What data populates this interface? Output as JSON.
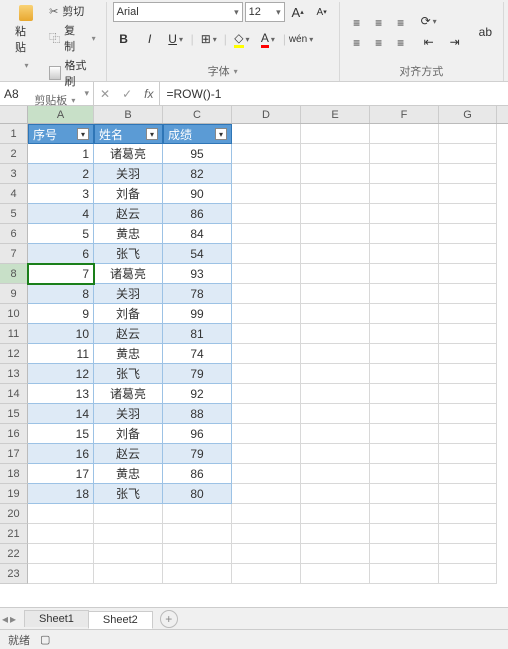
{
  "ribbon": {
    "clipboard": {
      "paste": "粘贴",
      "cut": "剪切",
      "copy": "复制",
      "format_painter": "格式刷",
      "group_label": "剪贴板"
    },
    "font": {
      "name": "Arial",
      "size": "12",
      "bold": "B",
      "italic": "I",
      "underline": "U",
      "grow": "A",
      "shrink": "A",
      "phonetic": "wén",
      "group_label": "字体"
    },
    "align": {
      "wrap": "ab",
      "group_label": "对齐方式"
    }
  },
  "name_box": "A8",
  "formula": "=ROW()-1",
  "columns": [
    "A",
    "B",
    "C",
    "D",
    "E",
    "F",
    "G"
  ],
  "col_widths": {
    "A": 66,
    "B": 69,
    "C": 69,
    "D": 69,
    "E": 69,
    "F": 69,
    "G": 58
  },
  "active": {
    "row": 8,
    "col": "A"
  },
  "table": {
    "headers": [
      "序号",
      "姓名",
      "成绩"
    ],
    "rows": [
      {
        "n": 1,
        "name": "诸葛亮",
        "score": 95
      },
      {
        "n": 2,
        "name": "关羽",
        "score": 82
      },
      {
        "n": 3,
        "name": "刘备",
        "score": 90
      },
      {
        "n": 4,
        "name": "赵云",
        "score": 86
      },
      {
        "n": 5,
        "name": "黄忠",
        "score": 84
      },
      {
        "n": 6,
        "name": "张飞",
        "score": 54
      },
      {
        "n": 7,
        "name": "诸葛亮",
        "score": 93
      },
      {
        "n": 8,
        "name": "关羽",
        "score": 78
      },
      {
        "n": 9,
        "name": "刘备",
        "score": 99
      },
      {
        "n": 10,
        "name": "赵云",
        "score": 81
      },
      {
        "n": 11,
        "name": "黄忠",
        "score": 74
      },
      {
        "n": 12,
        "name": "张飞",
        "score": 79
      },
      {
        "n": 13,
        "name": "诸葛亮",
        "score": 92
      },
      {
        "n": 14,
        "name": "关羽",
        "score": 88
      },
      {
        "n": 15,
        "name": "刘备",
        "score": 96
      },
      {
        "n": 16,
        "name": "赵云",
        "score": 79
      },
      {
        "n": 17,
        "name": "黄忠",
        "score": 86
      },
      {
        "n": 18,
        "name": "张飞",
        "score": 80
      }
    ]
  },
  "visible_row_count": 23,
  "sheets": {
    "list": [
      "Sheet1",
      "Sheet2"
    ],
    "active": "Sheet2"
  },
  "status_text": "就绪",
  "icons": {
    "fx": "fx",
    "check": "✓",
    "cancel": "✕"
  }
}
